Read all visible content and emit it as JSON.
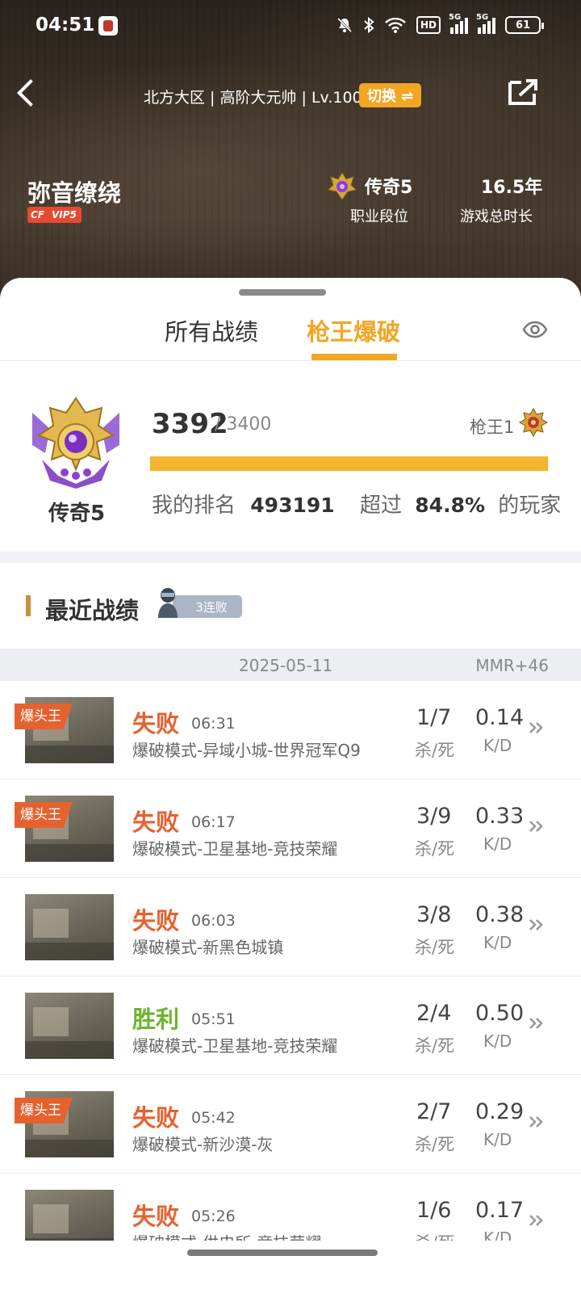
{
  "status_bar": {
    "time": "04:51",
    "hd": "HD",
    "net1": "5G",
    "net2": "5G",
    "battery": "61"
  },
  "header": {
    "server_line": "北方大区 | 高阶大元帅 | Lv.100",
    "switch_label": "切换 ⇌",
    "player_name": "弥音缭绕",
    "vip_label": "VIP5",
    "rank_name": "传奇5",
    "rank_label": "职业段位",
    "play_years": "16.5年",
    "play_years_label": "游戏总时长"
  },
  "tabs": [
    {
      "label": "所有战绩",
      "active": false
    },
    {
      "label": "枪王爆破",
      "active": true
    }
  ],
  "rank_panel": {
    "rank_name": "传奇5",
    "score": "3392",
    "score_max": "/ 3400",
    "progress": 0.9976,
    "next_rank": "枪王1",
    "my_rank_label": "我的排名",
    "my_rank": "493191",
    "exceed_label": "超过",
    "exceed_pct": "84.8%",
    "exceed_suffix": "的玩家"
  },
  "recent": {
    "title": "最近战绩",
    "streak": "3连败",
    "date": "2025-05-11",
    "mmr": "MMR+46"
  },
  "matches": [
    {
      "headshot": "爆头王",
      "result": "失败",
      "win": false,
      "time": "06:31",
      "mode": "爆破模式-异域小城-世界冠军Q9",
      "kd": "1/7",
      "kd_label": "杀/死",
      "ratio": "0.14",
      "ratio_label": "K/D"
    },
    {
      "headshot": "爆头王",
      "result": "失败",
      "win": false,
      "time": "06:17",
      "mode": "爆破模式-卫星基地-竞技荣耀",
      "kd": "3/9",
      "kd_label": "杀/死",
      "ratio": "0.33",
      "ratio_label": "K/D"
    },
    {
      "headshot": "",
      "result": "失败",
      "win": false,
      "time": "06:03",
      "mode": "爆破模式-新黑色城镇",
      "kd": "3/8",
      "kd_label": "杀/死",
      "ratio": "0.38",
      "ratio_label": "K/D"
    },
    {
      "headshot": "",
      "result": "胜利",
      "win": true,
      "time": "05:51",
      "mode": "爆破模式-卫星基地-竞技荣耀",
      "kd": "2/4",
      "kd_label": "杀/死",
      "ratio": "0.50",
      "ratio_label": "K/D"
    },
    {
      "headshot": "爆头王",
      "result": "失败",
      "win": false,
      "time": "05:42",
      "mode": "爆破模式-新沙漠-灰",
      "kd": "2/7",
      "kd_label": "杀/死",
      "ratio": "0.29",
      "ratio_label": "K/D"
    },
    {
      "headshot": "",
      "result": "失败",
      "win": false,
      "time": "05:26",
      "mode": "爆破模式-供电所-竞技荣耀",
      "kd": "1/6",
      "kd_label": "杀/死",
      "ratio": "0.17",
      "ratio_label": "K/D"
    }
  ]
}
